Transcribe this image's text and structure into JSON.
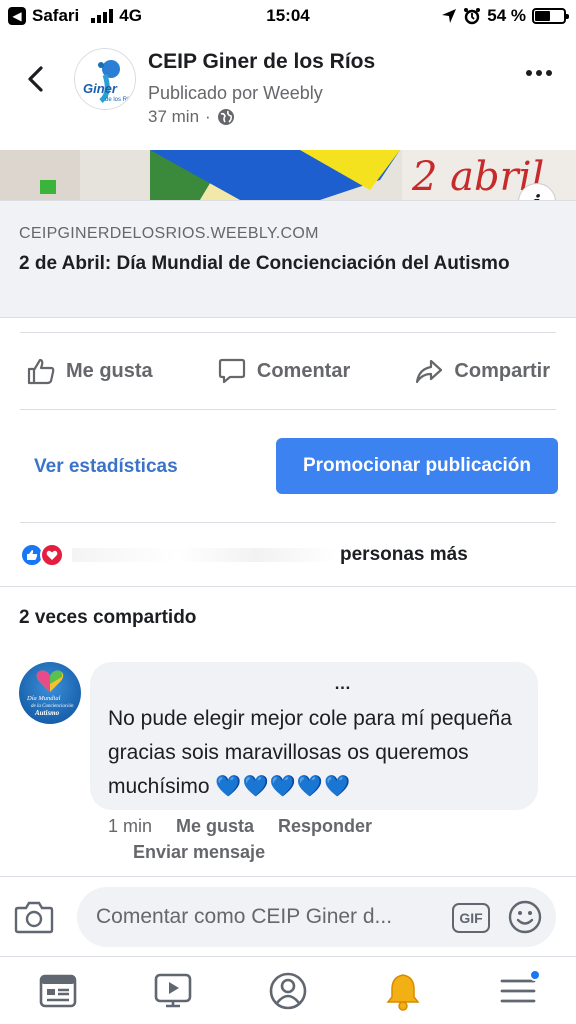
{
  "status_bar": {
    "carrier_app": "Safari",
    "network": "4G",
    "time": "15:04",
    "battery": "54 %",
    "battery_level": 0.54
  },
  "post": {
    "page_name": "CEIP Giner de los Ríos",
    "published_by": "Publicado por Weebly",
    "time_ago": "37 min",
    "separator": "·",
    "avatar_text": "Giner",
    "avatar_subtext": "de los Ríos"
  },
  "link_preview": {
    "image_text": "2 abril",
    "info_label": "i",
    "domain": "CEIPGINERDELOSRIOS.WEEBLY.COM",
    "title": "2 de Abril: Día Mundial de Concienciación del Autismo"
  },
  "actions": {
    "like": "Me gusta",
    "comment": "Comentar",
    "share": "Compartir"
  },
  "promotion": {
    "stats": "Ver estadísticas",
    "promote": "Promocionar publicación"
  },
  "reactions": {
    "others_text": "personas más"
  },
  "shares": {
    "text": "2 veces compartido"
  },
  "comment": {
    "author_fragment": "…",
    "text": "No pude elegir mejor cole para mí pequeña gracias sois maravillosas os queremos muchísimo",
    "hearts": "💙💙💙💙💙",
    "time": "1 min",
    "like": "Me gusta",
    "reply": "Responder",
    "message": "Enviar mensaje",
    "avatar_text": "Día Mundial de la Concienciación sobre el Autismo"
  },
  "composer": {
    "placeholder": "Comentar como CEIP Giner d...",
    "gif": "GIF"
  },
  "colors": {
    "accent": "#1877f2",
    "secondary_text": "#65676b",
    "background_gray": "#f0f2f5",
    "notification": "#1877f2"
  },
  "icons": {
    "back": "chevron-left-icon",
    "more": "more-dots-icon",
    "globe": "globe-icon",
    "like": "thumbs-up-icon",
    "comment": "speech-bubble-icon",
    "share": "share-arrow-icon",
    "camera": "camera-icon",
    "emoji": "smiley-icon",
    "tabs": [
      "news-feed-icon",
      "video-icon",
      "profile-icon",
      "bell-icon",
      "menu-icon"
    ]
  }
}
